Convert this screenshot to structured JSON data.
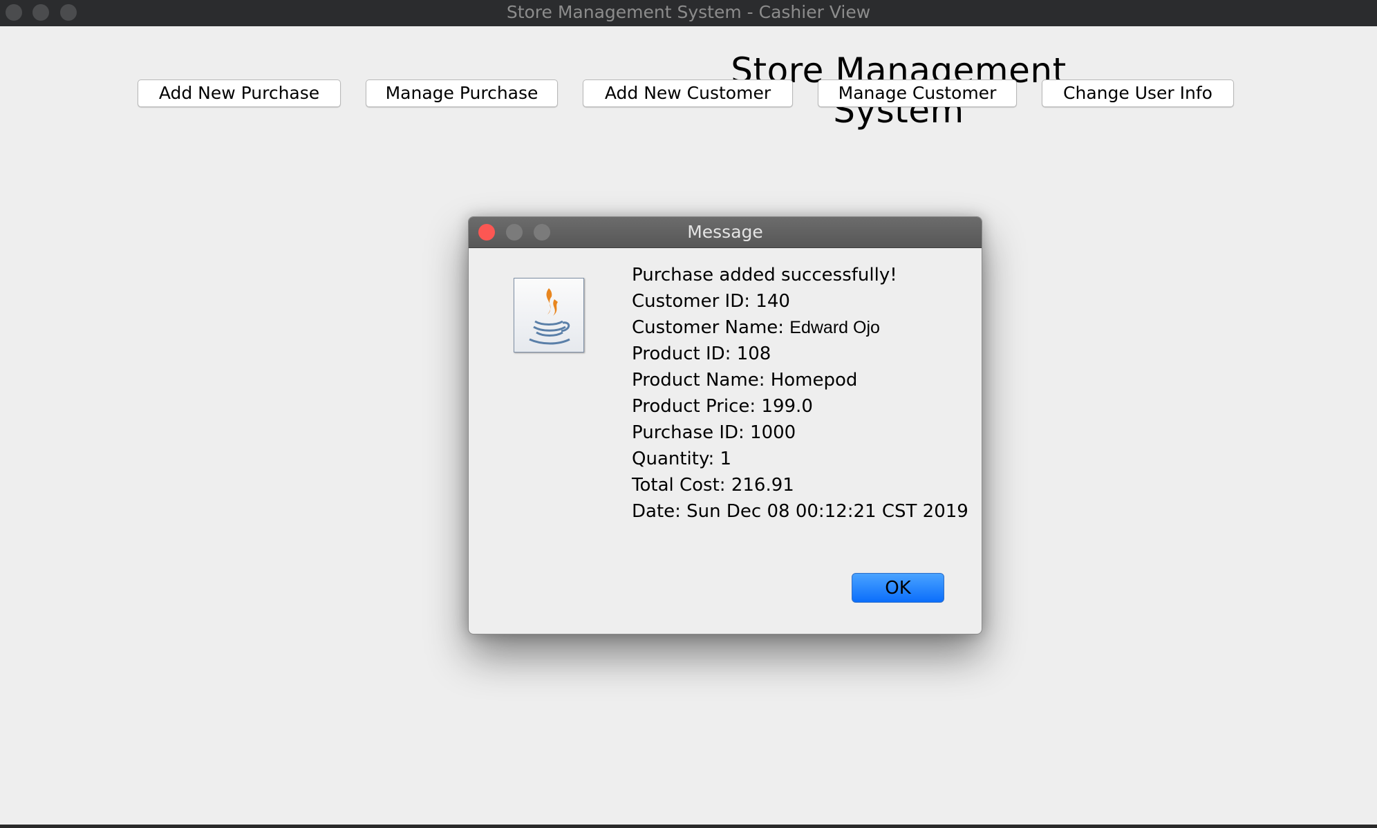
{
  "window": {
    "title": "Store Management System - Cashier View"
  },
  "header": {
    "title": "Store Management System"
  },
  "toolbar": {
    "buttons": [
      "Add New Purchase",
      "Manage Purchase",
      "Add New Customer",
      "Manage Customer",
      "Change User Info"
    ]
  },
  "dialog": {
    "title": "Message",
    "icon": "java-icon",
    "lines": {
      "status": "Purchase added successfully!",
      "customer_id": "Customer ID: 140",
      "customer_name_label": "Customer Name:",
      "customer_name_value": "Edward Ojo",
      "product_id": "Product ID: 108",
      "product_name": "Product Name: Homepod",
      "product_price": "Product Price: 199.0",
      "purchase_id": "Purchase ID: 1000",
      "quantity": "Quantity: 1",
      "total_cost": "Total Cost: 216.91",
      "date": "Date: Sun Dec 08 00:12:21 CST 2019"
    },
    "ok_label": "OK"
  },
  "colors": {
    "titlebar": "#2b2c2e",
    "content_background": "#eeeeee",
    "dialog_close_button": "#fc5753",
    "ok_button": "#0b6efb"
  }
}
